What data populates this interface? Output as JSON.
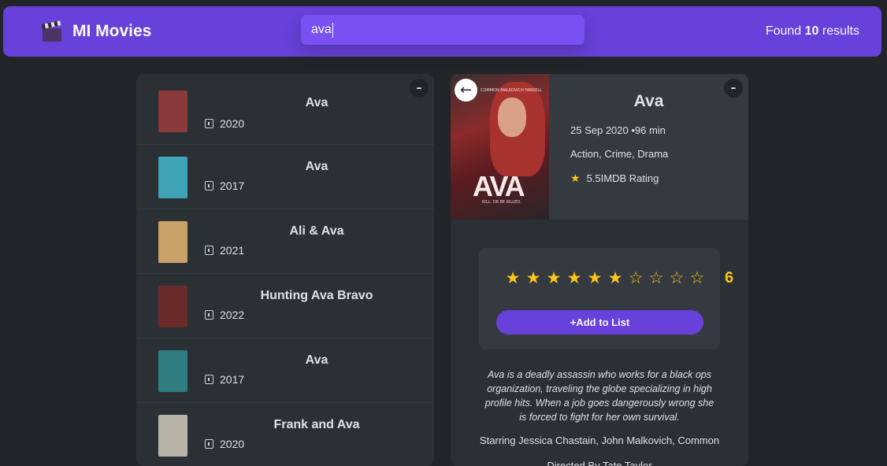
{
  "header": {
    "logo_icon": "clapperboard-icon",
    "app_title": "MI Movies",
    "search_value": "ava",
    "found_prefix": "Found ",
    "found_count": "10",
    "found_suffix": " results"
  },
  "list": {
    "toggle_label": "–",
    "movies": [
      {
        "title": "Ava",
        "year": "2020",
        "poster_color": "#8a3a3a"
      },
      {
        "title": "Ava",
        "year": "2017",
        "poster_color": "#3fa3b8"
      },
      {
        "title": "Ali & Ava",
        "year": "2021",
        "poster_color": "#c9a26a"
      },
      {
        "title": "Hunting Ava Bravo",
        "year": "2022",
        "poster_color": "#6a2a2a"
      },
      {
        "title": "Ava",
        "year": "2017",
        "poster_color": "#2f7d80"
      },
      {
        "title": "Frank and Ava",
        "year": "2020",
        "poster_color": "#b8b3a8"
      }
    ]
  },
  "detail": {
    "toggle_label": "–",
    "back_label": "←",
    "title": "Ava",
    "release": "25 Sep 2020 •96 min",
    "genre": "Action, Crime, Drama",
    "rating_star": "★",
    "imdb_rating": "5.5IMDB Rating",
    "poster_logo": "AVA",
    "poster_tagline": "KILL. OR BE KILLED.",
    "poster_credits": "COMMON   MALKOVICH   FARRELL",
    "user_rating": {
      "value": 6,
      "max": 10,
      "display": "6",
      "star_on": "★",
      "star_off": "☆"
    },
    "add_button": "+Add to List",
    "plot": "Ava is a deadly assassin who works for a black ops organization, traveling the globe specializing in high profile hits. When a job goes dangerously wrong she is forced to fight for her own survival.",
    "starring": "Starring Jessica Chastain, John Malkovich, Common",
    "directed": "Directed By Tate Taylor"
  }
}
